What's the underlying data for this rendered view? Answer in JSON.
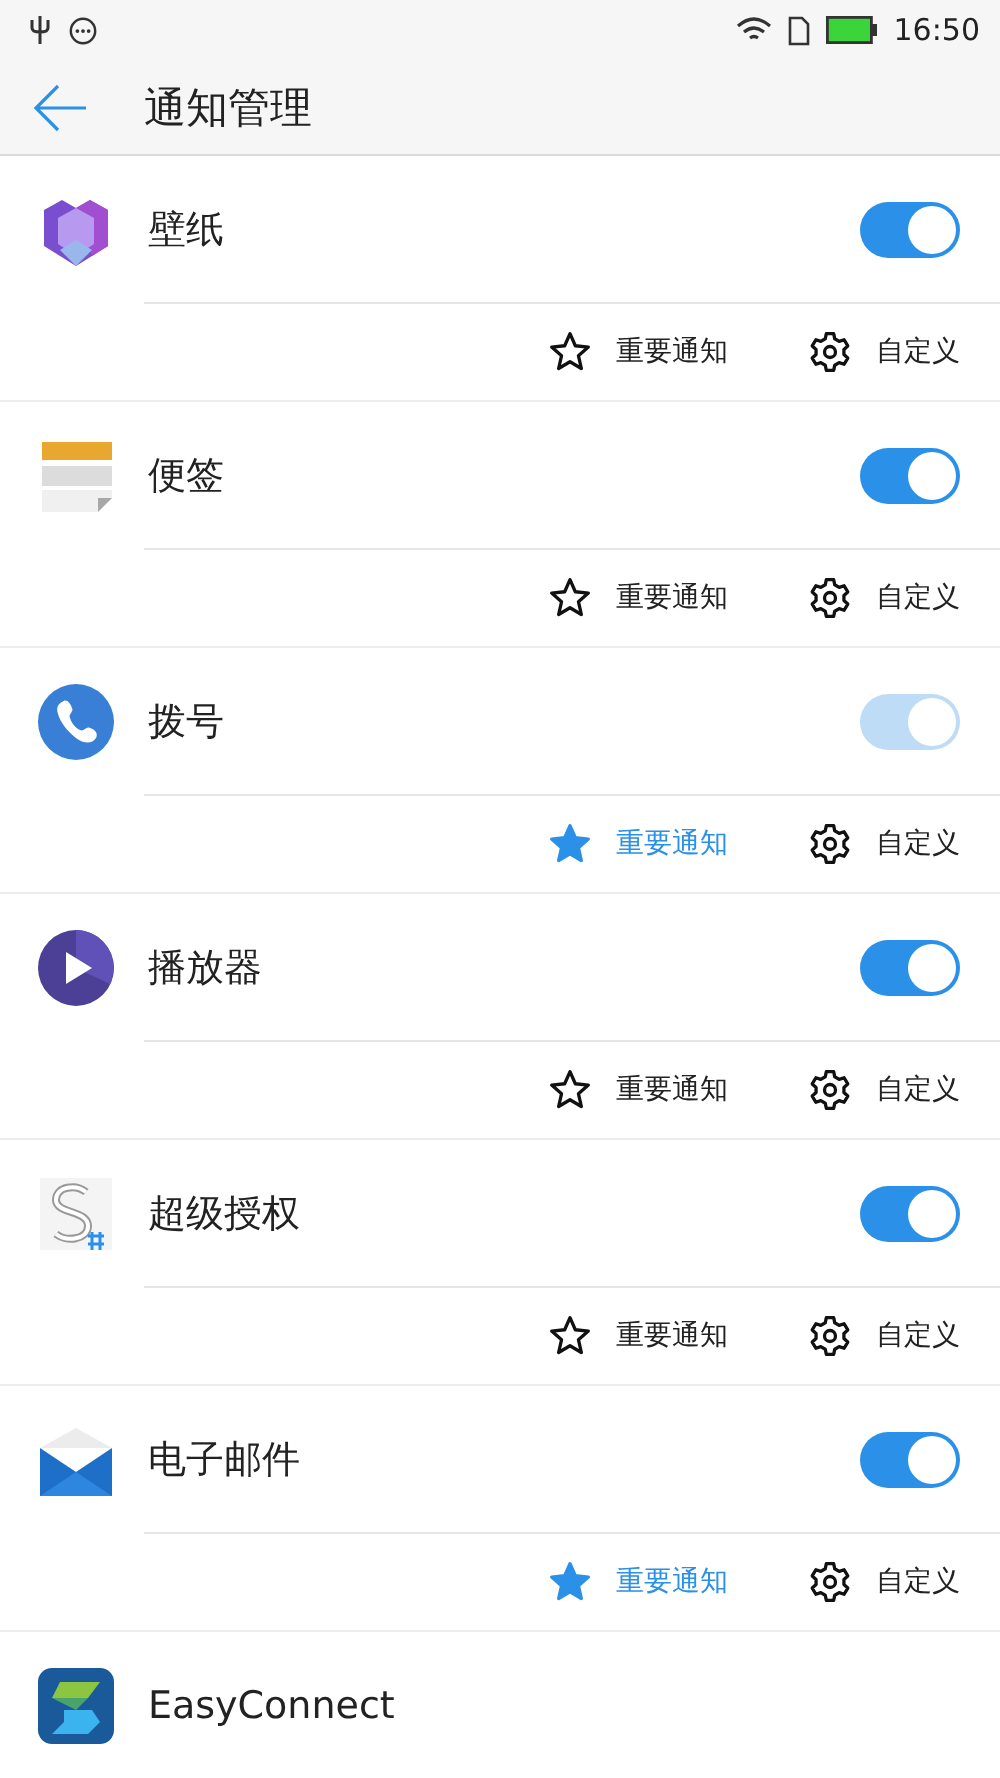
{
  "status_bar": {
    "time": "16:50"
  },
  "header": {
    "title": "通知管理"
  },
  "apps": [
    {
      "name": "壁纸",
      "on": true,
      "disabled": false,
      "important": {
        "label": "重要通知",
        "selected": false
      },
      "custom": "自定义"
    },
    {
      "name": "便签",
      "on": true,
      "disabled": false,
      "important": {
        "label": "重要通知",
        "selected": false
      },
      "custom": "自定义"
    },
    {
      "name": "拨号",
      "on": true,
      "disabled": true,
      "important": {
        "label": "重要通知",
        "selected": true
      },
      "custom": "自定义"
    },
    {
      "name": "播放器",
      "on": true,
      "disabled": false,
      "important": {
        "label": "重要通知",
        "selected": false
      },
      "custom": "自定义"
    },
    {
      "name": "超级授权",
      "on": true,
      "disabled": false,
      "important": {
        "label": "重要通知",
        "selected": false
      },
      "custom": "自定义"
    },
    {
      "name": "电子邮件",
      "on": true,
      "disabled": false,
      "important": {
        "label": "重要通知",
        "selected": true
      },
      "custom": "自定义"
    },
    {
      "name": "EasyConnect"
    }
  ]
}
